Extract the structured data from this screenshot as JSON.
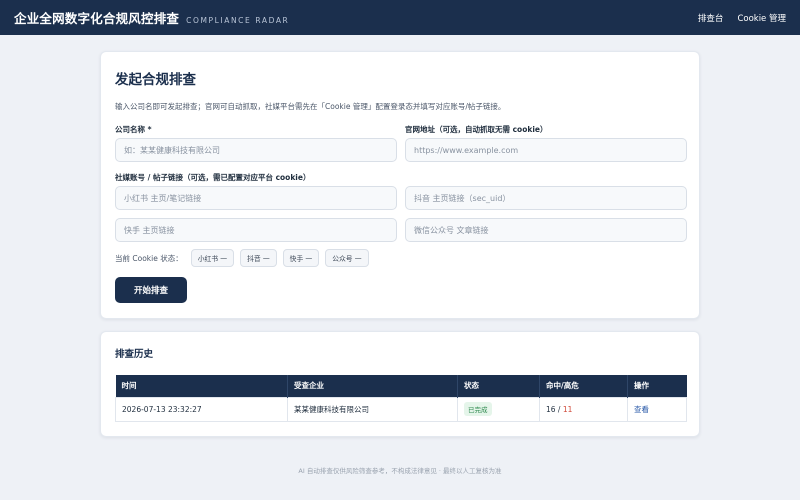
{
  "header": {
    "title": "企业全网数字化合规风控排查",
    "subtitle": "COMPLIANCE RADAR",
    "nav": [
      "排查台",
      "Cookie 管理"
    ]
  },
  "form": {
    "title": "发起合规排查",
    "description": "输入公司名即可发起排查；官网可自动抓取，社媒平台需先在「Cookie 管理」配置登录态并填写对应账号/帖子链接。",
    "company_label": "公司名称 *",
    "company_placeholder": "如：某某健康科技有限公司",
    "website_label": "官网地址（可选，自动抓取无需 cookie）",
    "website_placeholder": "https://www.example.com",
    "social_label": "社媒账号 / 帖子链接（可选，需已配置对应平台 cookie）",
    "xhs_placeholder": "小红书 主页/笔记链接",
    "douyin_placeholder": "抖音 主页链接（sec_uid）",
    "kuaishou_placeholder": "快手 主页链接",
    "wechat_placeholder": "微信公众号 文章链接",
    "cookie_status_label": "当前 Cookie 状态：",
    "cookie_chips": [
      "小红书 一",
      "抖音 一",
      "快手 一",
      "公众号 一"
    ],
    "submit_label": "开始排查"
  },
  "history": {
    "title": "排查历史",
    "columns": [
      "时间",
      "受查企业",
      "状态",
      "命中/高危",
      "操作"
    ],
    "rows": [
      {
        "time": "2026-07-13 23:32:27",
        "company": "某某健康科技有限公司",
        "status": "已完成",
        "hits": "16",
        "sep": " / ",
        "high": "11",
        "action": "查看"
      }
    ]
  },
  "footer": "AI 自动排查仅供风险筛查参考，不构成法律意见 · 最终以人工复核为准",
  "colors": {
    "navy": "#1b2f4d",
    "background": "#eef1f6",
    "success": "#2f8a4f",
    "danger": "#d04a3a"
  }
}
